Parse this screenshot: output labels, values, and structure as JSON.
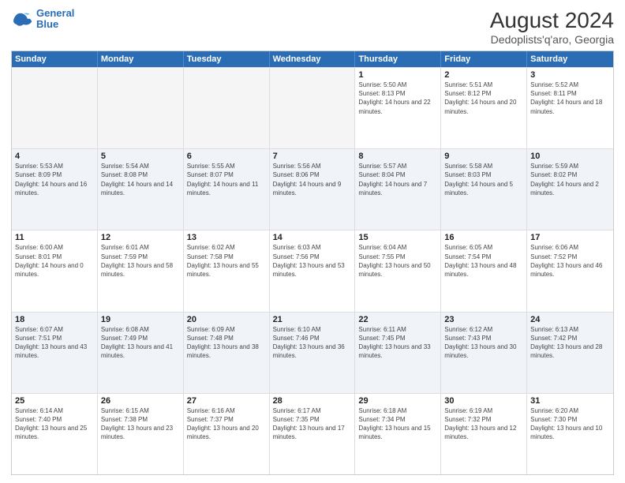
{
  "header": {
    "logo_line1": "General",
    "logo_line2": "Blue",
    "title": "August 2024",
    "subtitle": "Dedoplists'q'aro, Georgia"
  },
  "weekdays": [
    "Sunday",
    "Monday",
    "Tuesday",
    "Wednesday",
    "Thursday",
    "Friday",
    "Saturday"
  ],
  "weeks": [
    [
      {
        "day": "",
        "empty": true
      },
      {
        "day": "",
        "empty": true
      },
      {
        "day": "",
        "empty": true
      },
      {
        "day": "",
        "empty": true
      },
      {
        "day": "1",
        "sunrise": "5:50 AM",
        "sunset": "8:13 PM",
        "daylight": "14 hours and 22 minutes."
      },
      {
        "day": "2",
        "sunrise": "5:51 AM",
        "sunset": "8:12 PM",
        "daylight": "14 hours and 20 minutes."
      },
      {
        "day": "3",
        "sunrise": "5:52 AM",
        "sunset": "8:11 PM",
        "daylight": "14 hours and 18 minutes."
      }
    ],
    [
      {
        "day": "4",
        "sunrise": "5:53 AM",
        "sunset": "8:09 PM",
        "daylight": "14 hours and 16 minutes."
      },
      {
        "day": "5",
        "sunrise": "5:54 AM",
        "sunset": "8:08 PM",
        "daylight": "14 hours and 14 minutes."
      },
      {
        "day": "6",
        "sunrise": "5:55 AM",
        "sunset": "8:07 PM",
        "daylight": "14 hours and 11 minutes."
      },
      {
        "day": "7",
        "sunrise": "5:56 AM",
        "sunset": "8:06 PM",
        "daylight": "14 hours and 9 minutes."
      },
      {
        "day": "8",
        "sunrise": "5:57 AM",
        "sunset": "8:04 PM",
        "daylight": "14 hours and 7 minutes."
      },
      {
        "day": "9",
        "sunrise": "5:58 AM",
        "sunset": "8:03 PM",
        "daylight": "14 hours and 5 minutes."
      },
      {
        "day": "10",
        "sunrise": "5:59 AM",
        "sunset": "8:02 PM",
        "daylight": "14 hours and 2 minutes."
      }
    ],
    [
      {
        "day": "11",
        "sunrise": "6:00 AM",
        "sunset": "8:01 PM",
        "daylight": "14 hours and 0 minutes."
      },
      {
        "day": "12",
        "sunrise": "6:01 AM",
        "sunset": "7:59 PM",
        "daylight": "13 hours and 58 minutes."
      },
      {
        "day": "13",
        "sunrise": "6:02 AM",
        "sunset": "7:58 PM",
        "daylight": "13 hours and 55 minutes."
      },
      {
        "day": "14",
        "sunrise": "6:03 AM",
        "sunset": "7:56 PM",
        "daylight": "13 hours and 53 minutes."
      },
      {
        "day": "15",
        "sunrise": "6:04 AM",
        "sunset": "7:55 PM",
        "daylight": "13 hours and 50 minutes."
      },
      {
        "day": "16",
        "sunrise": "6:05 AM",
        "sunset": "7:54 PM",
        "daylight": "13 hours and 48 minutes."
      },
      {
        "day": "17",
        "sunrise": "6:06 AM",
        "sunset": "7:52 PM",
        "daylight": "13 hours and 46 minutes."
      }
    ],
    [
      {
        "day": "18",
        "sunrise": "6:07 AM",
        "sunset": "7:51 PM",
        "daylight": "13 hours and 43 minutes."
      },
      {
        "day": "19",
        "sunrise": "6:08 AM",
        "sunset": "7:49 PM",
        "daylight": "13 hours and 41 minutes."
      },
      {
        "day": "20",
        "sunrise": "6:09 AM",
        "sunset": "7:48 PM",
        "daylight": "13 hours and 38 minutes."
      },
      {
        "day": "21",
        "sunrise": "6:10 AM",
        "sunset": "7:46 PM",
        "daylight": "13 hours and 36 minutes."
      },
      {
        "day": "22",
        "sunrise": "6:11 AM",
        "sunset": "7:45 PM",
        "daylight": "13 hours and 33 minutes."
      },
      {
        "day": "23",
        "sunrise": "6:12 AM",
        "sunset": "7:43 PM",
        "daylight": "13 hours and 30 minutes."
      },
      {
        "day": "24",
        "sunrise": "6:13 AM",
        "sunset": "7:42 PM",
        "daylight": "13 hours and 28 minutes."
      }
    ],
    [
      {
        "day": "25",
        "sunrise": "6:14 AM",
        "sunset": "7:40 PM",
        "daylight": "13 hours and 25 minutes."
      },
      {
        "day": "26",
        "sunrise": "6:15 AM",
        "sunset": "7:38 PM",
        "daylight": "13 hours and 23 minutes."
      },
      {
        "day": "27",
        "sunrise": "6:16 AM",
        "sunset": "7:37 PM",
        "daylight": "13 hours and 20 minutes."
      },
      {
        "day": "28",
        "sunrise": "6:17 AM",
        "sunset": "7:35 PM",
        "daylight": "13 hours and 17 minutes."
      },
      {
        "day": "29",
        "sunrise": "6:18 AM",
        "sunset": "7:34 PM",
        "daylight": "13 hours and 15 minutes."
      },
      {
        "day": "30",
        "sunrise": "6:19 AM",
        "sunset": "7:32 PM",
        "daylight": "13 hours and 12 minutes."
      },
      {
        "day": "31",
        "sunrise": "6:20 AM",
        "sunset": "7:30 PM",
        "daylight": "13 hours and 10 minutes."
      }
    ]
  ]
}
